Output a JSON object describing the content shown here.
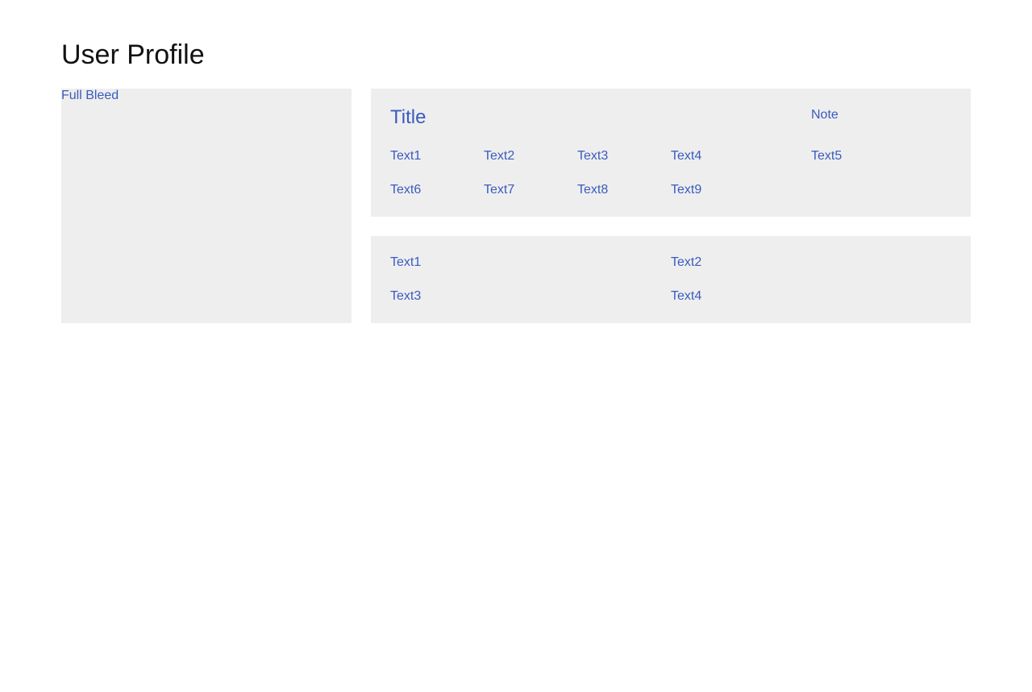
{
  "page": {
    "title": "User Profile"
  },
  "left_panel": {
    "label": "Full Bleed"
  },
  "top_card": {
    "title": "Title",
    "note": "Note",
    "row1": [
      "Text1",
      "Text2",
      "Text3",
      "Text4",
      "Text5"
    ],
    "row2": [
      "Text6",
      "Text7",
      "Text8",
      "Text9"
    ]
  },
  "bottom_card": {
    "row1": [
      "Text1",
      "Text2"
    ],
    "row2": [
      "Text3",
      "Text4"
    ]
  },
  "colors": {
    "accent": "#3a5bbf",
    "panel_bg": "#eeeeee",
    "title": "#111111"
  }
}
